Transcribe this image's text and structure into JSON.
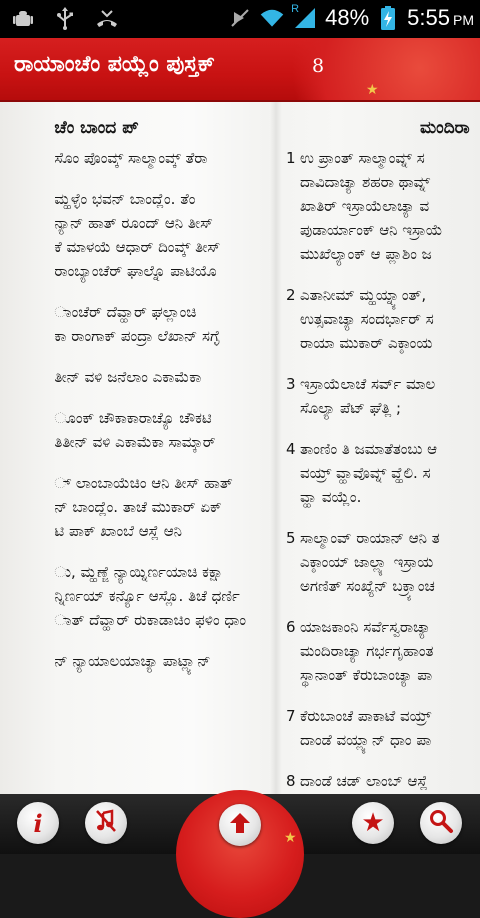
{
  "status_bar": {
    "battery_percent": "48%",
    "time": "5:55",
    "time_suffix": "PM",
    "network_label": "R"
  },
  "header": {
    "title": "ರಾಯಾಂಚೆಂ ಪಯ್ಲೆಂ ಪುಸ್ತಕ್",
    "chapter": "8"
  },
  "left_column": {
    "heading": "ಚೆಂ ಬಾಂದ ಪ್",
    "lines": [
      "ಸೊಂ ಪೊಂವ್ಕ್ ಸಾಲ್ಮಾಂವ್ಕ್ ತೆರಾ",
      "",
      "ಮ್ಹಳ್ಳೆಂ ಭವನ್ ಬಾಂದ್ಲೆಂ. ತೆಂ",
      "ನ್ಯಾನ್ ಹಾತ್ ರೂಂದ್ ಆನಿ ತೀಸ್",
      "ಕೆ ಮಾಳಯೆ ಆಧಾರ್ ದಿಂವ್ಕ್ ತೀಸ್",
      "ರಾಂಬ್ಯಾಂಚೆರ್ ಘಾಲ್ನೊ ಪಾಟಿಯೊ",
      "",
      "ಾಂಚೆರ್ ದೆವ್ಹಾರ್ ಘಲ್ಲಾಂಚಿ",
      "ಕಾ ರಾಂಗಾಕ್ ಪಂದ್ರಾ ಲೆಖಾನ್ ಸಗ್ಳೆ",
      "",
      "ತೀನ್ ವಳಿ ಜನೆಲಾಂ ಎಕಾಮೆಕಾ",
      "",
      "ೂಂಕ್ ಚೌಕಾಕಾರಾಚ್ಯೊ ಚೌಕಟಿ",
      "ತಿತೀನ್ ವಳಿ ಎಕಾಮೆಕಾ ಸಾಮ್ಕಾರ್",
      "",
      "್ ಲಾಂಬಾಯೆಚಿಂ ಆನಿ ತೀಸ್ ಹಾತ್",
      "ನ್ ಬಾಂದ್ಲೆಂ. ತಾಚೆ ಮುಕಾರ್ ಏಕ್",
      "ಟಿ ಪಾಕ್ ಖಾಂಬೆ ಆಸ್ಲೆ ಆನಿ",
      "",
      "ು, ಮ್ಹಣ್ಜೆ ನ್ಯಾಯ್ನಿರ್ಣಯಾಚಿ ಕಕ್ಷಾ",
      "ನ್ನಿರ್ಣಯ್ ಕರ್ನ್ಯೊ ಆಸ್ಲೊ. ತಿಚೆ ಧರ್ಣಿ",
      "ಾತ್ ದೆವ್ಹಾರ್ ರುಕಾಡಾಚಿಂ ಫಳಿಂ ಧಾಂ",
      "",
      "ನ್ ನ್ಯಾಯಾಲಯಾಚ್ಯಾ ಪಾಟ್ಲ್ಯಾನ್"
    ]
  },
  "right_column": {
    "heading": "ಮಂದಿರಾ",
    "verses": [
      {
        "num": "1",
        "lines": [
          "ಉ ಪ್ರಾಂತ್ ಸಾಲ್ಮಾಂವ್ನ್ ಸ",
          "ದಾವಿದಾಚ್ಯಾ ಶಹರಾ ಥಾವ್ನ್",
          "ಖಾತಿರ್ ಇಸ್ರಾಯೆಲಾಚ್ಯಾ ವ",
          "ಪುಡಾರ್ಯಾಂಕ್ ಆನಿ ಇಸ್ರಾಯೆ",
          "ಮುಖೆಲ್ಯಾಂಕ್ ಆ ಪ್ಲಾಶಿಂ ಜ"
        ]
      },
      {
        "num": "2",
        "lines": [
          "ಎತಾನೀಮ್ ಮ್ಹಯ್ನ್ಯಾಂತ್,",
          "ಉತ್ಸವಾಚ್ಯಾ ಸಂದರ್ಭಾರ್ ಸ",
          "ರಾಯಾ ಮುಕಾರ್ ಎಕ್ಠಾಂಯ"
        ]
      },
      {
        "num": "3",
        "lines": [
          "ಇಸ್ರಾಯೆಲಾಚೆ ಸರ್ವ್ ಮಾಲ",
          "ಸೊಲ್ಯಾ ಪೆಟ್ ಘೆತ್ಲಿ ;"
        ]
      },
      {
        "num": "4",
        "lines": [
          "ತಾಂಣಿಂ ತಿ ಜಮಾತೆತಂಬು ಆ",
          "ವಯ್ರ್ ವ್ಹಾವೊವ್ನ್ ವ್ಹೆಲಿ. ಸ",
          "ವ್ಹಾ ವಯ್ಲೆಂ."
        ]
      },
      {
        "num": "5",
        "lines": [
          "ಸಾಲ್ಮಾಂವ್ ರಾಯಾನ್ ಆನಿ ತ",
          "ಎಕ್ಠಾಂಯ್ ಜಾಲ್ಲ್ಯಾ ಇಸ್ರಾಯ",
          "ಅಗಣಿತ್ ಸಂಖ್ಯೆನ್ ಬಕ್ರ್ಯಾಂಚ"
        ]
      },
      {
        "num": "6",
        "lines": [
          "ಯಾಜಕಾಂನಿ ಸರ್ವೆಸ್ವರಾಚ್ಯಾ",
          "ಮಂದಿರಾಚ್ಯಾ ಗರ್ಭಗೃಹಾಂತ",
          "ಸ್ಥಾನಾಂತ್ ಕೆರುಬಾಂಚ್ಯಾ ಪಾ"
        ]
      },
      {
        "num": "7",
        "lines": [
          "ಕೆರುಬಾಂಚೆ ಪಾಕಾಟೆ ವಯ್ರ್",
          "ದಾಂಡೆ ವಯ್ಲ್ಯಾನ್ ಧಾಂ ಪಾ"
        ]
      },
      {
        "num": "8",
        "lines": [
          "ದಾಂಡೆ ಚಡ್ ಲಾಂಬ್ ಆಸ್ಲೆ",
          "ಮುಕ್ಯಾ ಪವಿತ್ರ್ ಸ್ಥಾನಾಂತ್",
          "ತ್ಲೊ ದಿಸನಾತ್ಲೊ. (ತೆ ಆಜ"
        ]
      }
    ]
  },
  "toolbar": {
    "info": "i",
    "mute": "mute",
    "up": "up",
    "favorites": "star",
    "search": "search"
  },
  "colors": {
    "accent": "#d41c1c",
    "page_bg": "#f7f7f5",
    "text": "#151515",
    "star": "#f2c84b"
  }
}
